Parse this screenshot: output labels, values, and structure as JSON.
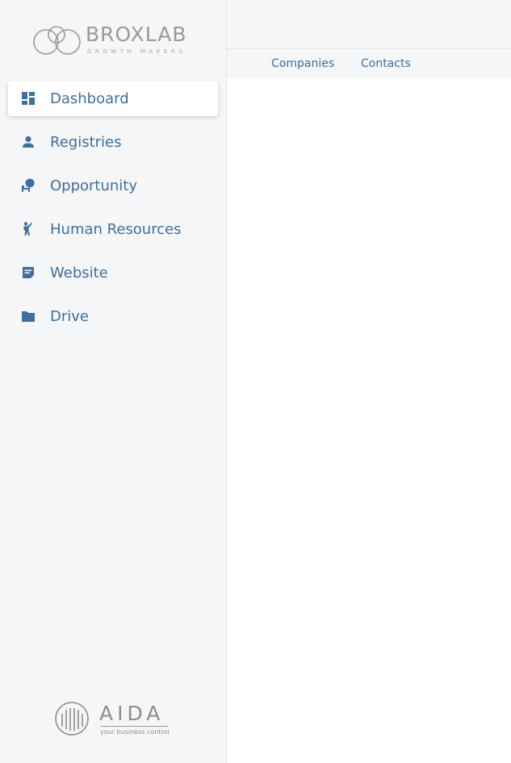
{
  "brand": {
    "name": "BROXLAB",
    "tagline": "GROWTH MAKERS"
  },
  "sidebar": {
    "items": [
      {
        "label": "Dashboard",
        "icon": "dashboard-icon",
        "active": true
      },
      {
        "label": "Registries",
        "icon": "person-icon",
        "active": false
      },
      {
        "label": "Opportunity",
        "icon": "opportunity-icon",
        "active": false
      },
      {
        "label": "Human Resources",
        "icon": "human-resources-icon",
        "active": false
      },
      {
        "label": "Website",
        "icon": "website-icon",
        "active": false
      },
      {
        "label": "Drive",
        "icon": "folder-icon",
        "active": false
      }
    ]
  },
  "topbar": {
    "tabs": [
      {
        "label": "Companies"
      },
      {
        "label": "Contacts"
      }
    ]
  },
  "footer_logo": {
    "name": "AIDA",
    "tagline": "your business control"
  },
  "colors": {
    "accent": "#3d6f9f",
    "sidebar_bg": "#f5f6f8",
    "content_bg": "#ffffff"
  }
}
